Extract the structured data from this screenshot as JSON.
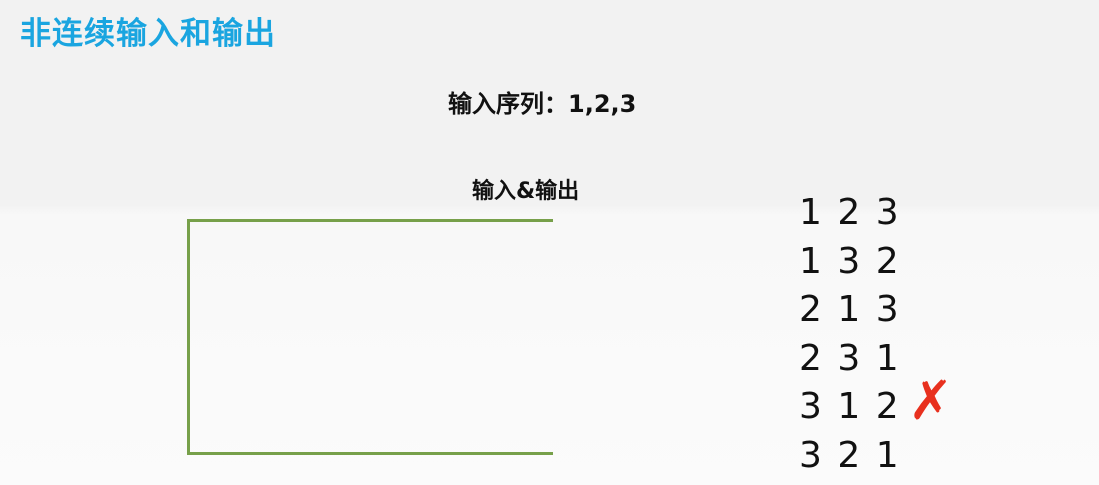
{
  "title": "非连续输入和输出",
  "input_sequence": "输入序列：1,2,3",
  "io_label": "输入&输出",
  "permutations": [
    {
      "text": "1 2 3"
    },
    {
      "text": "1 3 2"
    },
    {
      "text": "2 1 3"
    },
    {
      "text": "2 3 1"
    },
    {
      "text": "3 1 2",
      "invalid": true
    },
    {
      "text": "3 2 1"
    }
  ],
  "invalid_mark": "✗",
  "colors": {
    "title": "#1aa5e0",
    "stack_border": "#77a04a",
    "invalid_mark": "#e8301e"
  }
}
